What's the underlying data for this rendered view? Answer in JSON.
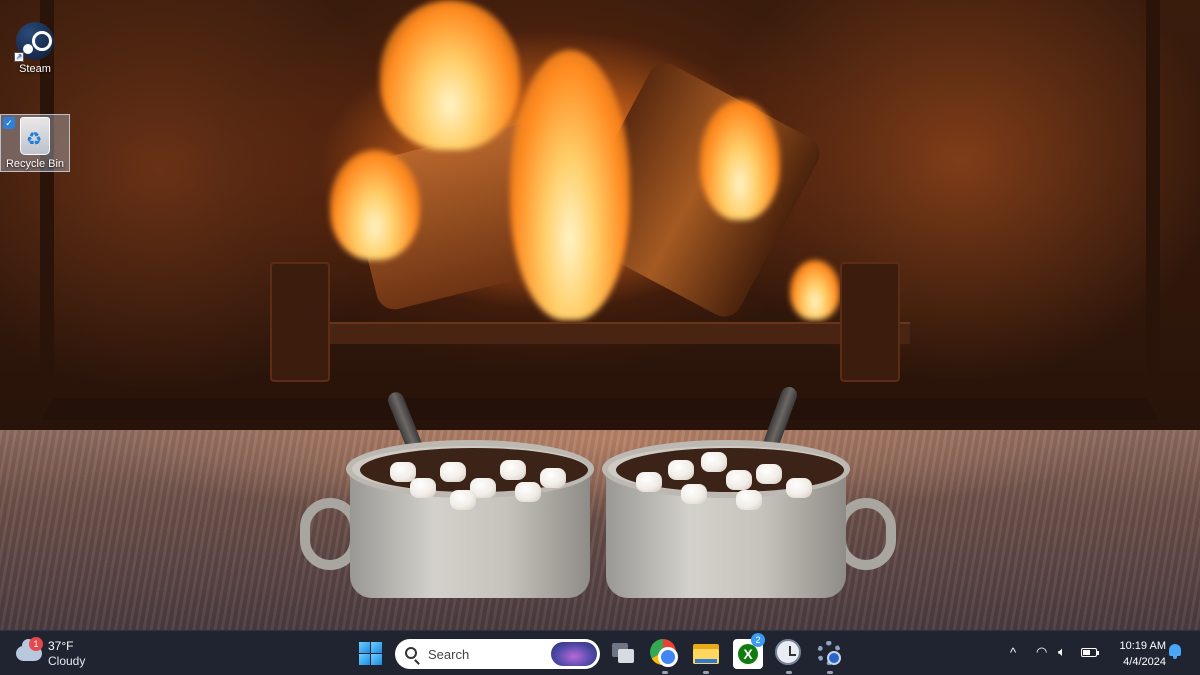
{
  "desktop": {
    "icons": [
      {
        "label": "Steam",
        "icon": "steam-icon"
      },
      {
        "label": "Recycle Bin",
        "icon": "recycle-bin-icon",
        "selected": true
      }
    ],
    "wallpaper": "fireplace with two mugs of hot cocoa and marshmallows on a fur rug"
  },
  "taskbar": {
    "weather": {
      "temperature": "37°F",
      "condition": "Cloudy",
      "badge_count": "1",
      "icon": "cloud-icon"
    },
    "search": {
      "placeholder": "Search"
    },
    "pinned_apps": [
      {
        "name": "Task View",
        "icon": "task-view-icon"
      },
      {
        "name": "Google Chrome",
        "icon": "chrome-icon",
        "running": true
      },
      {
        "name": "File Explorer",
        "icon": "folder-icon",
        "running": true
      },
      {
        "name": "Xbox",
        "icon": "xbox-icon",
        "badge": "2"
      },
      {
        "name": "Clock",
        "icon": "clock-icon",
        "running": true
      },
      {
        "name": "Settings",
        "icon": "gear-icon",
        "running": true
      }
    ],
    "tray": {
      "chevron": "^",
      "wifi": "wifi-icon",
      "volume": "volume-icon",
      "battery": "battery-icon",
      "battery_level": 0.55
    },
    "clock": {
      "time": "10:19 AM",
      "date": "4/4/2024"
    },
    "notifications": {
      "icon": "bell-icon"
    }
  },
  "colors": {
    "taskbar_bg": "#1f2430",
    "accent": "#4aa6f5",
    "badge_red": "#e5484d"
  }
}
